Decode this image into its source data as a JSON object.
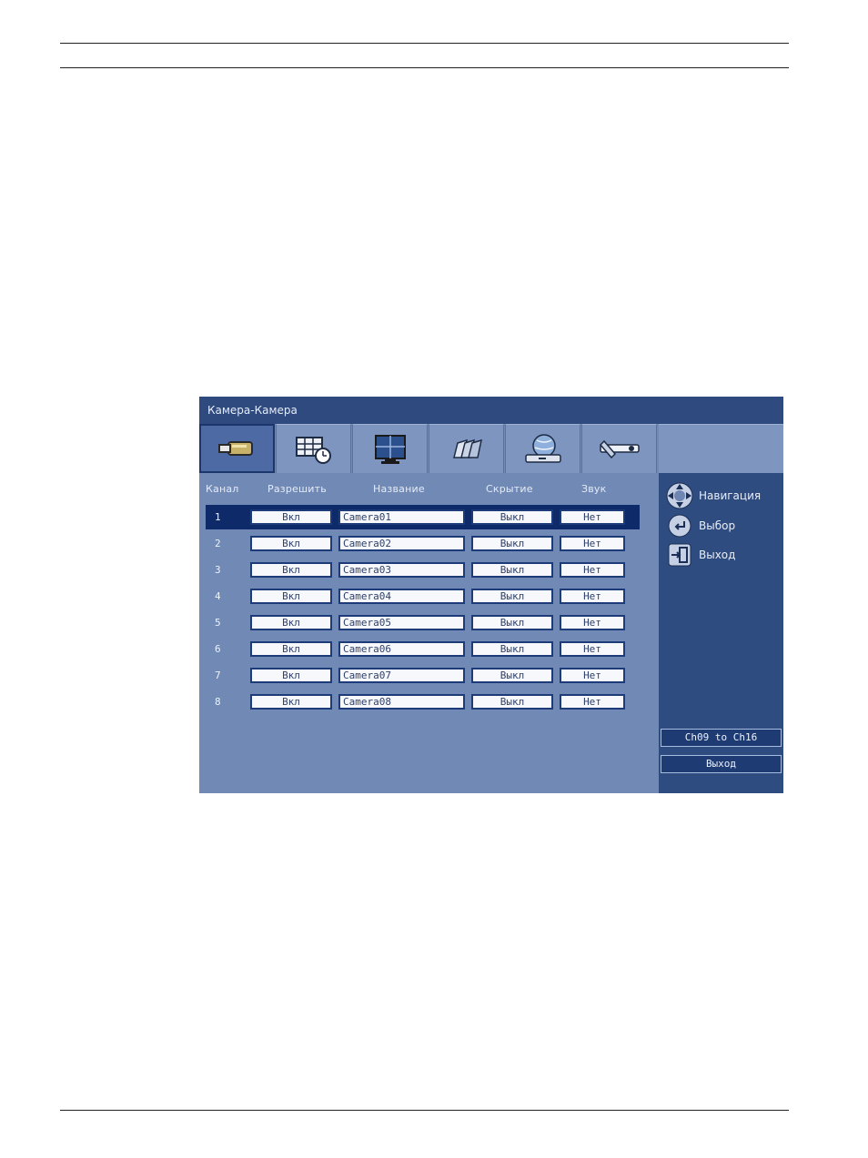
{
  "window": {
    "title": "Камера-Камера"
  },
  "tabs": [
    {
      "icon": "camera-icon"
    },
    {
      "icon": "schedule-icon"
    },
    {
      "icon": "monitor-icon"
    },
    {
      "icon": "recording-icon"
    },
    {
      "icon": "network-icon"
    },
    {
      "icon": "tools-icon"
    }
  ],
  "table": {
    "headers": {
      "channel": "Канал",
      "enable": "Разрешить",
      "name": "Название",
      "hide": "Скрытие",
      "sound": "Звук"
    },
    "rows": [
      {
        "ch": "1",
        "enable": "Вкл",
        "name": "Camera01",
        "hide": "Выкл",
        "sound": "Нет",
        "selected": true
      },
      {
        "ch": "2",
        "enable": "Вкл",
        "name": "Camera02",
        "hide": "Выкл",
        "sound": "Нет"
      },
      {
        "ch": "3",
        "enable": "Вкл",
        "name": "Camera03",
        "hide": "Выкл",
        "sound": "Нет"
      },
      {
        "ch": "4",
        "enable": "Вкл",
        "name": "Camera04",
        "hide": "Выкл",
        "sound": "Нет"
      },
      {
        "ch": "5",
        "enable": "Вкл",
        "name": "Camera05",
        "hide": "Выкл",
        "sound": "Нет"
      },
      {
        "ch": "6",
        "enable": "Вкл",
        "name": "Camera06",
        "hide": "Выкл",
        "sound": "Нет"
      },
      {
        "ch": "7",
        "enable": "Вкл",
        "name": "Camera07",
        "hide": "Выкл",
        "sound": "Нет"
      },
      {
        "ch": "8",
        "enable": "Вкл",
        "name": "Camera08",
        "hide": "Выкл",
        "sound": "Нет"
      }
    ]
  },
  "help": {
    "navigation": {
      "label": "Навигация",
      "icon": "navigation-pad-icon"
    },
    "select": {
      "label": "Выбор",
      "icon": "enter-icon"
    },
    "exit": {
      "label": "Выход",
      "icon": "exit-icon"
    }
  },
  "side_buttons": {
    "page": "Ch09 to Ch16",
    "exit": "Выход"
  },
  "colors": {
    "panel": "#7089b5",
    "titlebar": "#2e4a7e",
    "sidepanel": "#2f4c80",
    "selected_row": "#0f2a68"
  }
}
